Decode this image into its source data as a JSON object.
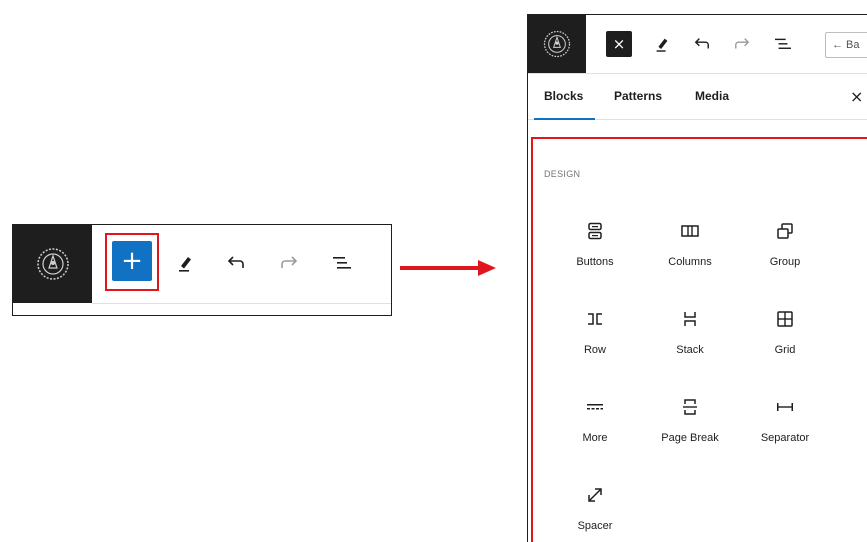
{
  "small_toolbar": {
    "logo": "site-logo",
    "buttons": [
      {
        "icon": "plus-icon",
        "label": "+"
      },
      {
        "icon": "pencil-icon"
      },
      {
        "icon": "undo-icon"
      },
      {
        "icon": "redo-icon"
      },
      {
        "icon": "list-view-icon"
      }
    ]
  },
  "panel": {
    "header": {
      "close_label": "×",
      "back_label": "← Ba"
    },
    "tabs": [
      {
        "label": "Blocks",
        "active": true
      },
      {
        "label": "Patterns",
        "active": false
      },
      {
        "label": "Media",
        "active": false
      }
    ],
    "tabs_close": "×",
    "section_title": "DESIGN",
    "blocks": [
      {
        "label": "Buttons",
        "icon": "buttons-icon"
      },
      {
        "label": "Columns",
        "icon": "columns-icon"
      },
      {
        "label": "Group",
        "icon": "group-icon"
      },
      {
        "label": "Row",
        "icon": "row-icon"
      },
      {
        "label": "Stack",
        "icon": "stack-icon"
      },
      {
        "label": "Grid",
        "icon": "grid-icon"
      },
      {
        "label": "More",
        "icon": "more-icon"
      },
      {
        "label": "Page Break",
        "icon": "page-break-icon"
      },
      {
        "label": "Separator",
        "icon": "separator-icon"
      },
      {
        "label": "Spacer",
        "icon": "spacer-icon"
      }
    ]
  },
  "colors": {
    "accent": "#1172c3",
    "highlight": "#e0161e",
    "toolbar_dark": "#1e1e1e"
  }
}
